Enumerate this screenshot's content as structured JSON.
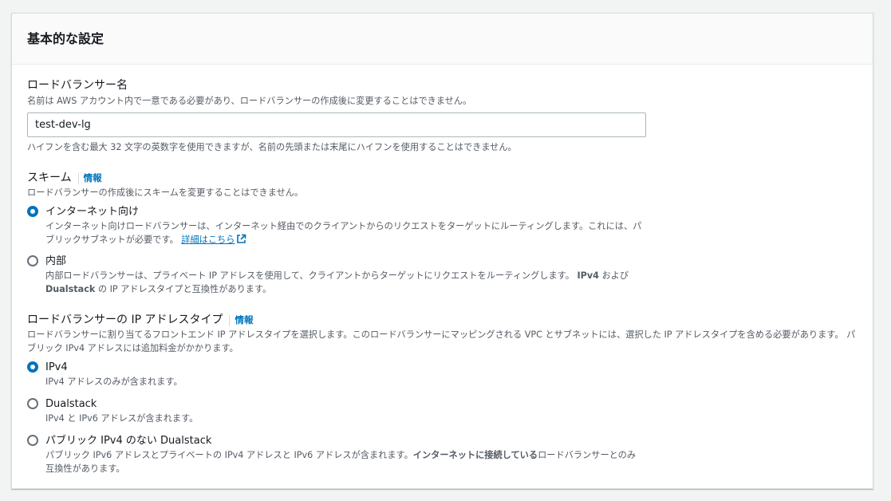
{
  "panel": {
    "title": "基本的な設定"
  },
  "lb_name": {
    "label": "ロードバランサー名",
    "description": "名前は AWS アカウント内で一意である必要があり、ロードバランサーの作成後に変更することはできません。",
    "value": "test-dev-lg",
    "constraint": "ハイフンを含む最大 32 文字の英数字を使用できますが、名前の先頭または末尾にハイフンを使用することはできません。"
  },
  "scheme": {
    "label": "スキーム",
    "info": "情報",
    "description": "ロードバランサーの作成後にスキームを変更することはできません。",
    "options": [
      {
        "label": "インターネット向け",
        "desc": "インターネット向けロードバランサーは、インターネット経由でのクライアントからのリクエストをターゲットにルーティングします。これには、パブリックサブネットが必要です。",
        "link": "詳細はこちら",
        "selected": true
      },
      {
        "label": "内部",
        "desc_a": "内部ロードバランサーは、プライベート IP アドレスを使用して、クライアントからターゲットにリクエストをルーティングします。",
        "desc_b1": "IPv4",
        "desc_c": "および",
        "desc_b2": "Dualstack",
        "desc_d": "の IP アドレスタイプと互換性があります。",
        "selected": false
      }
    ]
  },
  "ip_type": {
    "label": "ロードバランサーの IP アドレスタイプ",
    "info": "情報",
    "description": "ロードバランサーに割り当てるフロントエンド IP アドレスタイプを選択します。このロードバランサーにマッピングされる VPC とサブネットには、選択した IP アドレスタイプを含める必要があります。 パブリック IPv4 アドレスには追加料金がかかります。",
    "options": [
      {
        "label": "IPv4",
        "desc": "IPv4 アドレスのみが含まれます。",
        "selected": true
      },
      {
        "label": "Dualstack",
        "desc": "IPv4 と IPv6 アドレスが含まれます。",
        "selected": false
      },
      {
        "label": "パブリック IPv4 のない Dualstack",
        "desc_a": "パブリック IPv6 アドレスとプライベートの IPv4 アドレスと IPv6 アドレスが含まれます。",
        "desc_b": "インターネットに接続している",
        "desc_c": "ロードバランサーとのみ互換性があります。",
        "selected": false
      }
    ]
  },
  "colors": {
    "accent": "#0073bb",
    "text": "#16191f",
    "secondary": "#545b64"
  }
}
